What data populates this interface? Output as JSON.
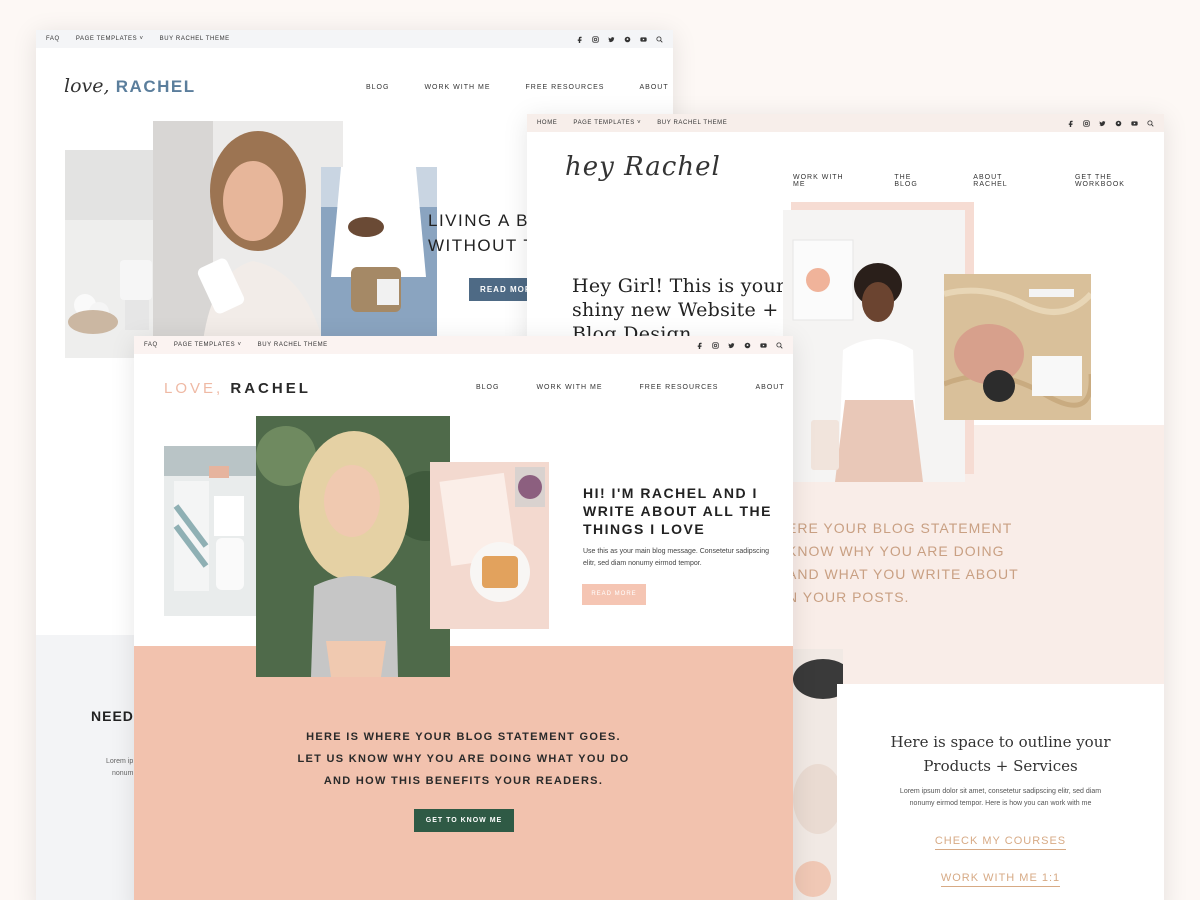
{
  "window1": {
    "topbar_links": [
      "FAQ",
      "PAGE TEMPLATES",
      "BUY RACHEL THEME"
    ],
    "logo_script": "love,",
    "logo_text": "RACHEL",
    "nav": [
      "BLOG",
      "WORK WITH ME",
      "FREE RESOURCES",
      "ABOUT"
    ],
    "hero_line1": "LIVING A BL",
    "hero_line2": "WITHOUT TH",
    "read_more": "READ MORE",
    "need_heading": "NEED",
    "lorem_line1": "Lorem ip",
    "lorem_line2": "nonum"
  },
  "window2": {
    "topbar_links": [
      "HOME",
      "PAGE TEMPLATES",
      "BUY RACHEL THEME"
    ],
    "logo": "hey Rachel",
    "nav": [
      "WORK WITH ME",
      "THE BLOG",
      "ABOUT RACHEL",
      "GET THE WORKBOOK"
    ],
    "hero_line1": "Hey Girl! This is your",
    "hero_line2": "shiny new Website +",
    "hero_line3": "Blog Design",
    "statement_line1": "ERE YOUR BLOG STATEMENT",
    "statement_line2": "KNOW WHY YOU ARE DOING",
    "statement_line3": "AND WHAT YOU WRITE ABOUT",
    "statement_line4": "N YOUR POSTS.",
    "products_line1": "Here is space to outline your",
    "products_line2": "Products + Services",
    "products_desc1": "Lorem ipsum dolor sit amet, consetetur sadipscing elitr, sed diam",
    "products_desc2": "nonumy eirmod tempor. Here is how you can work with me",
    "link_courses": "CHECK MY COURSES",
    "link_work": "WORK WITH ME 1:1"
  },
  "window3": {
    "topbar_links": [
      "FAQ",
      "PAGE TEMPLATES",
      "BUY RACHEL THEME"
    ],
    "logo_pink": "LOVE,",
    "logo_dark": "RACHEL",
    "nav": [
      "BLOG",
      "WORK WITH ME",
      "FREE RESOURCES",
      "ABOUT"
    ],
    "hi_title": "HI! I'M RACHEL AND I WRITE ABOUT ALL THE THINGS I LOVE",
    "hi_desc": "Use this as your main blog message. Consetetur sadipscing elitr, sed diam nonumy eirmod tempor.",
    "read_more": "READ MORE",
    "statement_line1": "HERE IS WHERE YOUR BLOG STATEMENT GOES.",
    "statement_line2": "LET US KNOW WHY YOU ARE DOING WHAT YOU DO",
    "statement_line3": "AND HOW THIS BENEFITS YOUR READERS.",
    "cta": "GET TO KNOW ME"
  },
  "icons": [
    "facebook-icon",
    "instagram-icon",
    "twitter-icon",
    "pinterest-icon",
    "youtube-icon",
    "search-icon"
  ],
  "colors": {
    "blue_accent": "#5b7e9c",
    "peach_band": "#f2c2ae",
    "blush_band": "#f9ede8",
    "gold_text": "#c9a083",
    "green_button": "#2f5a45"
  }
}
